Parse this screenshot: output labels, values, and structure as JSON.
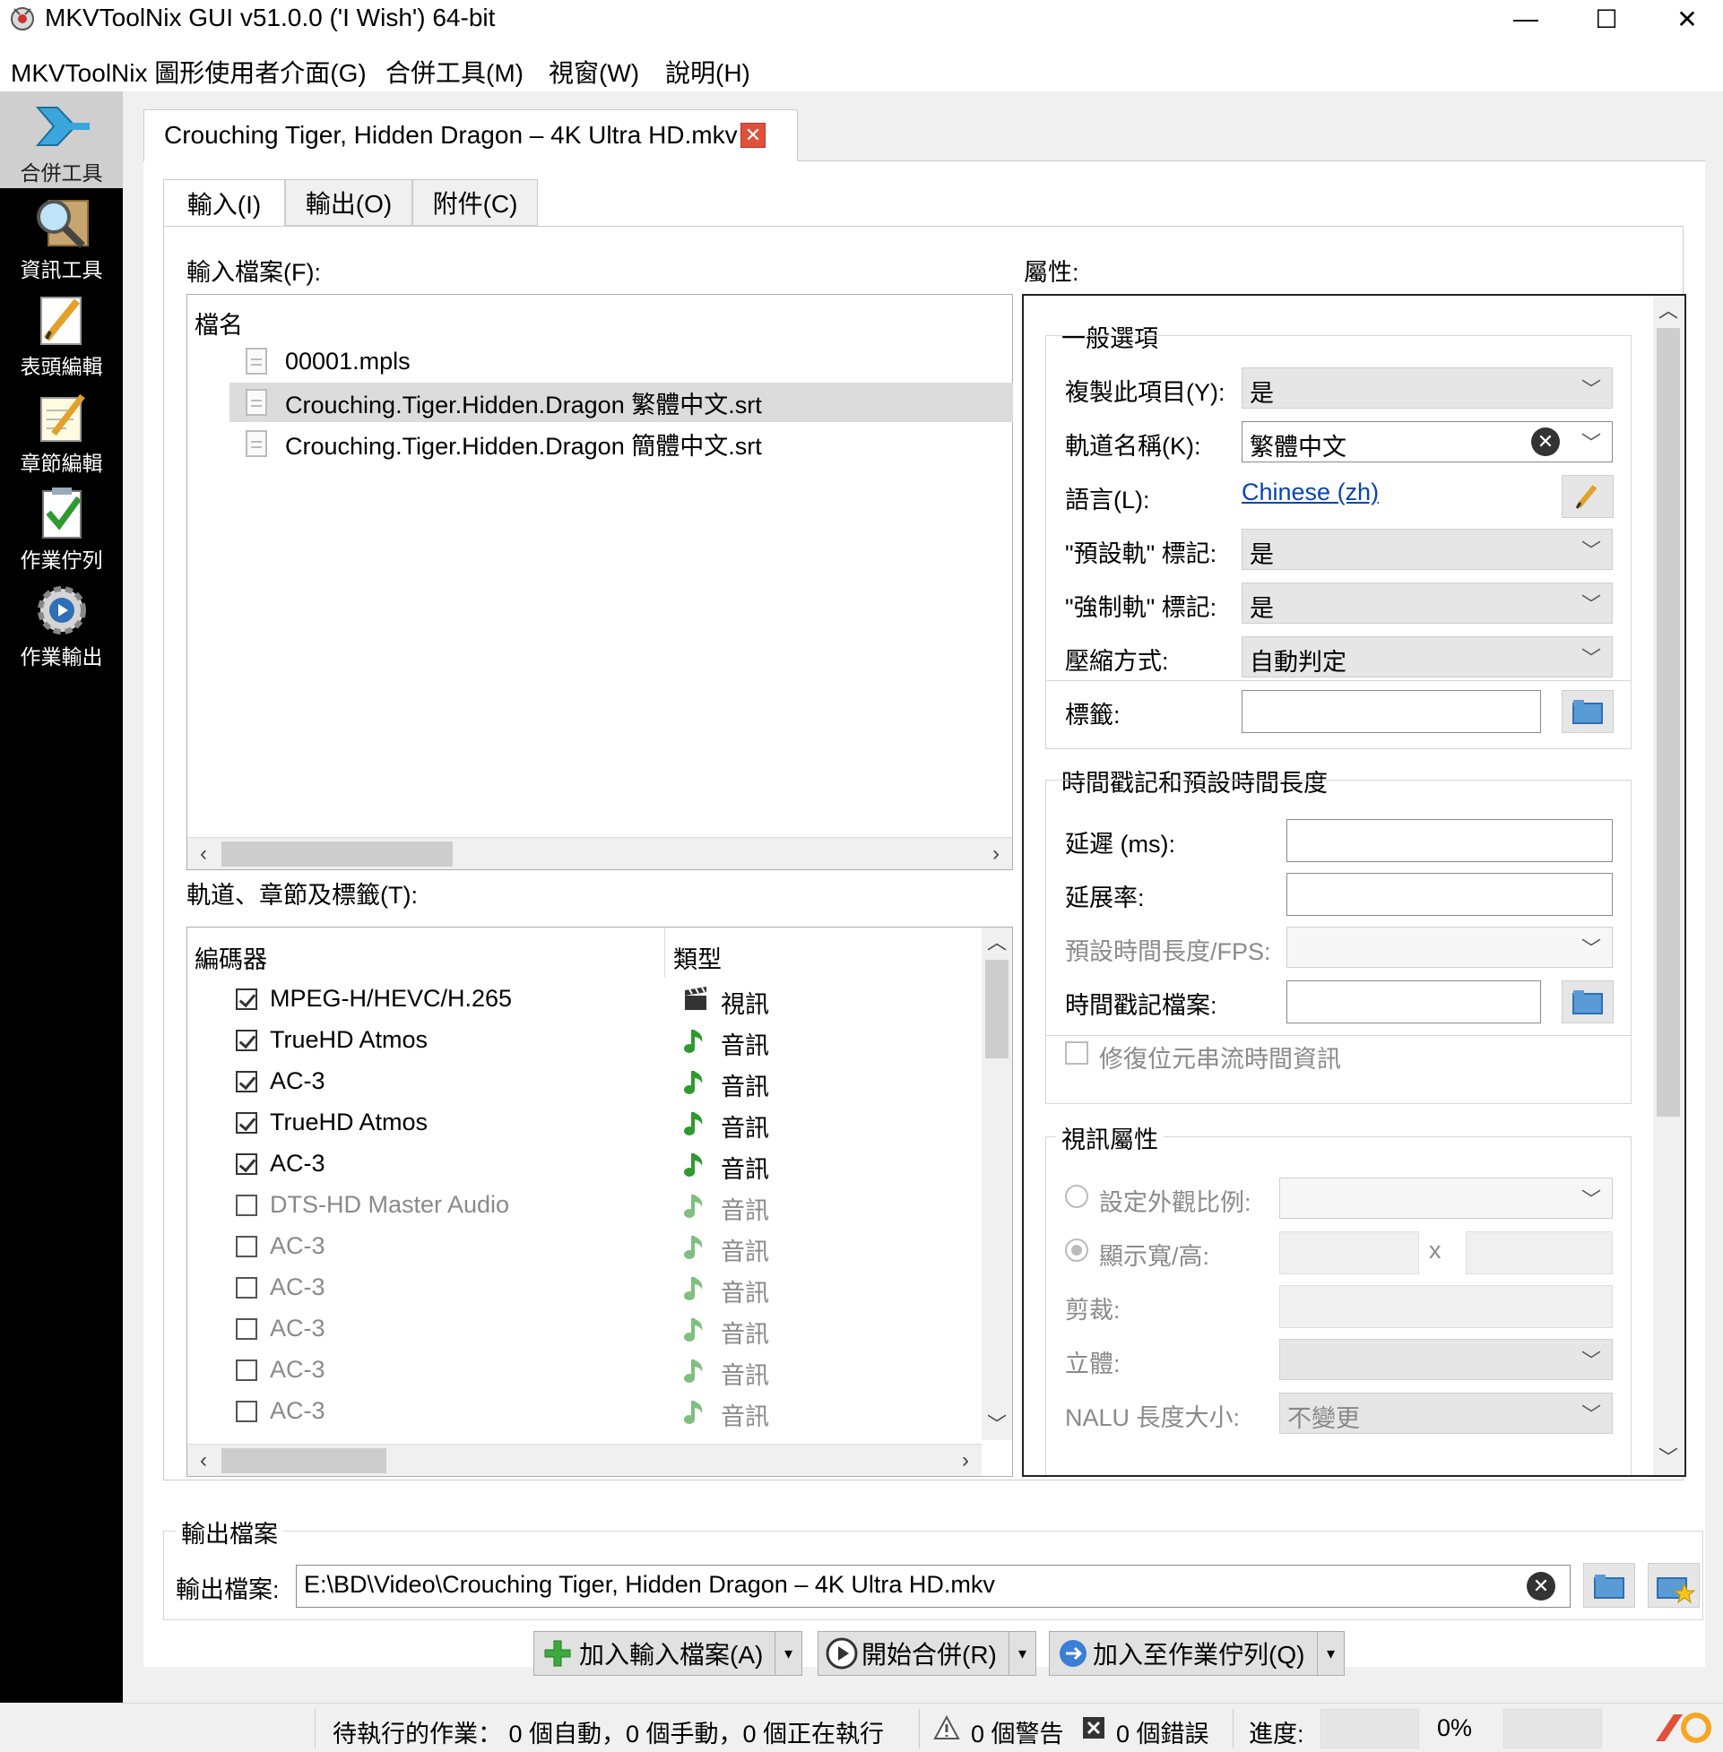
{
  "window": {
    "title": "MKVToolNix GUI v51.0.0 ('I Wish') 64-bit",
    "minimize": "—",
    "maximize": "☐",
    "close": "✕"
  },
  "menubar": [
    "MKVToolNix 圖形使用者介面(G)",
    "合併工具(M)",
    "視窗(W)",
    "說明(H)"
  ],
  "sidebar": [
    {
      "label": "合併工具",
      "icon": "merge-arrow-icon",
      "active": true
    },
    {
      "label": "資訊工具",
      "icon": "magnifier-icon"
    },
    {
      "label": "表頭編輯",
      "icon": "pencil-note-icon"
    },
    {
      "label": "章節編輯",
      "icon": "pencil-paper-icon"
    },
    {
      "label": "作業佇列",
      "icon": "checklist-icon"
    },
    {
      "label": "作業輸出",
      "icon": "gear-play-icon"
    }
  ],
  "document_tab": {
    "label": "Crouching Tiger, Hidden Dragon – 4K Ultra HD.mkv",
    "close": "✕"
  },
  "subtabs": [
    "輸入(I)",
    "輸出(O)",
    "附件(C)"
  ],
  "input_files": {
    "label": "輸入檔案(F):",
    "header": "檔名",
    "files": [
      "00001.mpls",
      "Crouching.Tiger.Hidden.Dragon 繁體中文.srt",
      "Crouching.Tiger.Hidden.Dragon 簡體中文.srt"
    ],
    "selected_index": 1,
    "scroll_left": "‹",
    "scroll_right": "›"
  },
  "tracks": {
    "label": "軌道、章節及標籤(T):",
    "headers": [
      "編碼器",
      "類型"
    ],
    "rows": [
      {
        "codec": "MPEG-H/HEVC/H.265",
        "type": "視訊",
        "checked": true,
        "kind": "video"
      },
      {
        "codec": "TrueHD Atmos",
        "type": "音訊",
        "checked": true,
        "kind": "audio"
      },
      {
        "codec": "AC-3",
        "type": "音訊",
        "checked": true,
        "kind": "audio"
      },
      {
        "codec": "TrueHD Atmos",
        "type": "音訊",
        "checked": true,
        "kind": "audio"
      },
      {
        "codec": "AC-3",
        "type": "音訊",
        "checked": true,
        "kind": "audio"
      },
      {
        "codec": "DTS-HD Master Audio",
        "type": "音訊",
        "checked": false,
        "kind": "audio"
      },
      {
        "codec": "AC-3",
        "type": "音訊",
        "checked": false,
        "kind": "audio"
      },
      {
        "codec": "AC-3",
        "type": "音訊",
        "checked": false,
        "kind": "audio"
      },
      {
        "codec": "AC-3",
        "type": "音訊",
        "checked": false,
        "kind": "audio"
      },
      {
        "codec": "AC-3",
        "type": "音訊",
        "checked": false,
        "kind": "audio"
      },
      {
        "codec": "AC-3",
        "type": "音訊",
        "checked": false,
        "kind": "audio"
      }
    ]
  },
  "properties": {
    "label": "屬性:",
    "general": {
      "title": "一般選項",
      "copy_item_label": "複製此項目(Y):",
      "copy_item_value": "是",
      "track_name_label": "軌道名稱(K):",
      "track_name_value": "繁體中文",
      "language_label": "語言(L):",
      "language_value": "Chinese (zh)",
      "default_flag_label": "\"預設軌\" 標記:",
      "default_flag_value": "是",
      "forced_flag_label": "\"強制軌\" 標記:",
      "forced_flag_value": "是",
      "compression_label": "壓縮方式:",
      "compression_value": "自動判定",
      "tags_label": "標籤:",
      "tags_value": ""
    },
    "timing": {
      "title": "時間戳記和預設時間長度",
      "delay_label": "延遲 (ms):",
      "delay_value": "",
      "stretch_label": "延展率:",
      "stretch_value": "",
      "default_duration_label": "預設時間長度/FPS:",
      "default_duration_value": "",
      "timestamp_file_label": "時間戳記檔案:",
      "timestamp_file_value": "",
      "fix_bitstream_label": "修復位元串流時間資訊"
    },
    "video": {
      "title": "視訊屬性",
      "aspect_ratio_label": "設定外觀比例:",
      "display_wh_label": "顯示寬/高:",
      "x_sep": "x",
      "crop_label": "剪裁:",
      "stereo_label": "立體:",
      "nalu_label": "NALU 長度大小:",
      "nalu_value": "不變更"
    }
  },
  "output": {
    "group_title": "輸出檔案",
    "label": "輸出檔案:",
    "path": "E:\\BD\\Video\\Crouching Tiger, Hidden Dragon – 4K Ultra HD.mkv"
  },
  "actions": {
    "add_input": "加入輸入檔案(A)",
    "start_merge": "開始合併(R)",
    "add_queue": "加入至作業佇列(Q)",
    "dropdown": "▾"
  },
  "status": {
    "jobs": "待執行的作業： 0 個自動，0 個手動，0 個正在執行",
    "warnings": "0 個警告",
    "errors": "0 個錯誤",
    "progress_label": "進度:",
    "progress_value": "0%",
    "progress_fraction": 0
  },
  "colors": {
    "sidebar_bg": "#000000",
    "link": "#0645ad",
    "close_badge": "#e0503a",
    "selection": "#dcdcdc",
    "audio_icon": "#2f9a2f"
  }
}
